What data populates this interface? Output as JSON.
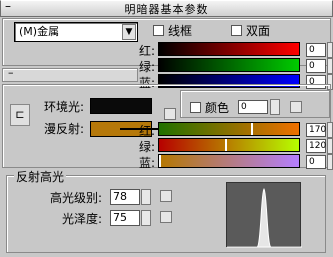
{
  "header": {
    "title": "明暗器基本参数",
    "collapse": "–"
  },
  "shader": {
    "value": "(M)金属",
    "dropdown_icon": "chevron-down-icon"
  },
  "options": [
    {
      "label": "线框",
      "checked": false
    },
    {
      "label": "双面",
      "checked": false
    }
  ],
  "color_picker_top": {
    "labels": [
      "红:",
      "绿:",
      "蓝:"
    ],
    "values": [
      "0",
      "0",
      "0"
    ]
  },
  "basic_params": {
    "collapse": "–",
    "ambient_label": "环境光:",
    "diffuse_label": "漫反射:",
    "ambient_color": "#0a0a0a",
    "diffuse_color": "#b5780a",
    "lock_icon": "lock-icon",
    "self_illum_label": "颜色",
    "self_illum_value": "0"
  },
  "color_picker_bottom": {
    "labels": [
      "红:",
      "绿:",
      "蓝:"
    ],
    "values": [
      "170",
      "120",
      "0"
    ],
    "levels": [
      0.67,
      0.47,
      0.0
    ]
  },
  "specular": {
    "section_title": "反射高光",
    "level_label": "高光级别:",
    "level_value": "78",
    "gloss_label": "光泽度:",
    "gloss_value": "75"
  },
  "colors": {
    "red_track": [
      "#000000",
      "#ff0000"
    ],
    "green_track": [
      "#000000",
      "#00cc00"
    ],
    "blue_track": [
      "#000000",
      "#0000ff"
    ],
    "diff_red_track": [
      "#207000",
      "#f07000"
    ],
    "diff_green_track": [
      "#b70000",
      "#b7ff00"
    ],
    "diff_blue_track": [
      "#b57800",
      "#b57eff"
    ]
  }
}
